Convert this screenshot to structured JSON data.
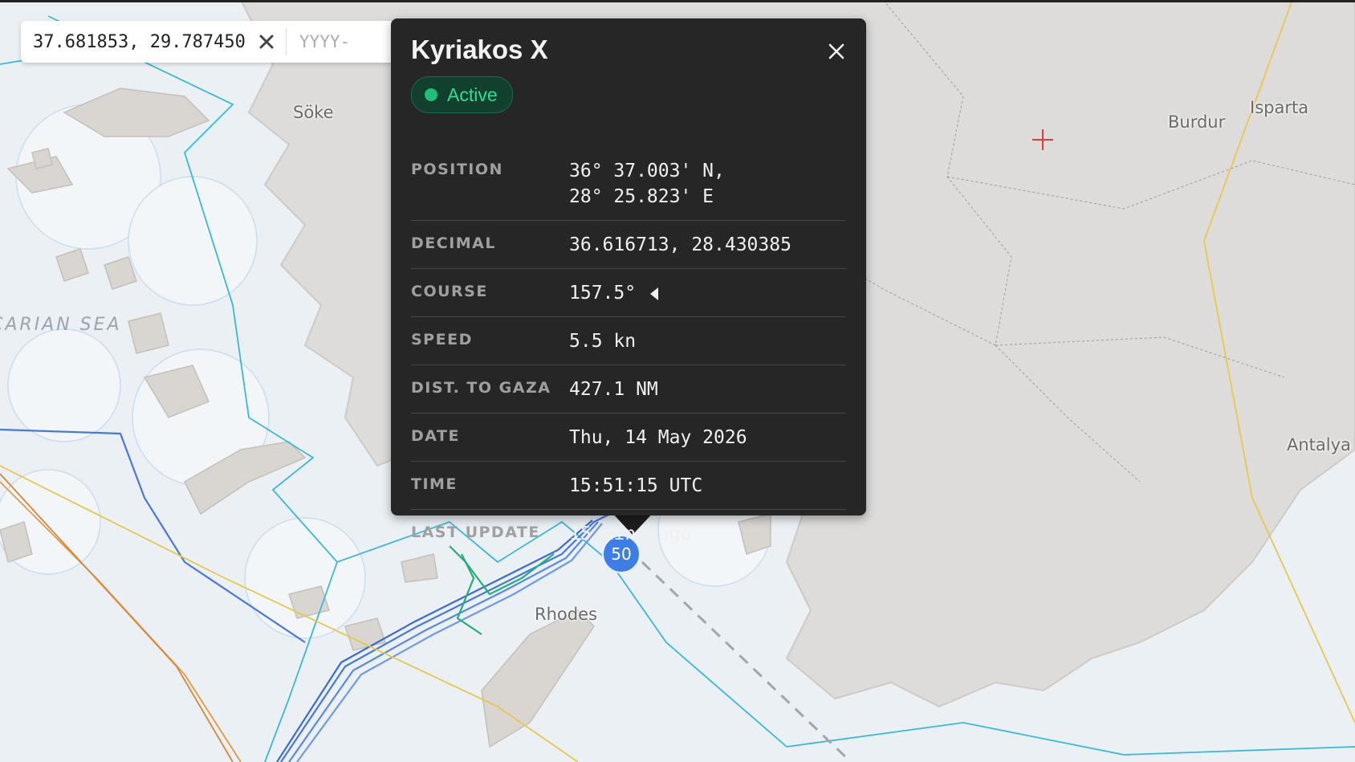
{
  "search": {
    "coordinates": "37.681853, 29.787450",
    "date_placeholder": "YYYY-"
  },
  "map": {
    "labels": {
      "soke": "Söke",
      "sea": "CARIAN SEA",
      "rhodes": "Rhodes",
      "burdur": "Burdur",
      "isparta": "Isparta",
      "antalya": "Antalya"
    },
    "cluster_count": "50"
  },
  "popup": {
    "title": "Kyriakos X",
    "status": "Active",
    "rows": [
      {
        "label": "POSITION",
        "value": "36° 37.003' N,",
        "value2": "28° 25.823' E"
      },
      {
        "label": "DECIMAL",
        "value": "36.616713, 28.430385"
      },
      {
        "label": "COURSE",
        "value": "157.5°"
      },
      {
        "label": "SPEED",
        "value": "5.5 kn"
      },
      {
        "label": "DIST. TO GAZA",
        "value": "427.1 NM"
      },
      {
        "label": "DATE",
        "value": "Thu, 14 May 2026"
      },
      {
        "label": "TIME",
        "value": "15:51:15 UTC"
      },
      {
        "label": "LAST UPDATE",
        "value": "15 mins ago"
      }
    ]
  },
  "colors": {
    "status_green": "#2ee08f",
    "cluster_blue": "#3d7ee6",
    "popup_bg": "#262626"
  }
}
